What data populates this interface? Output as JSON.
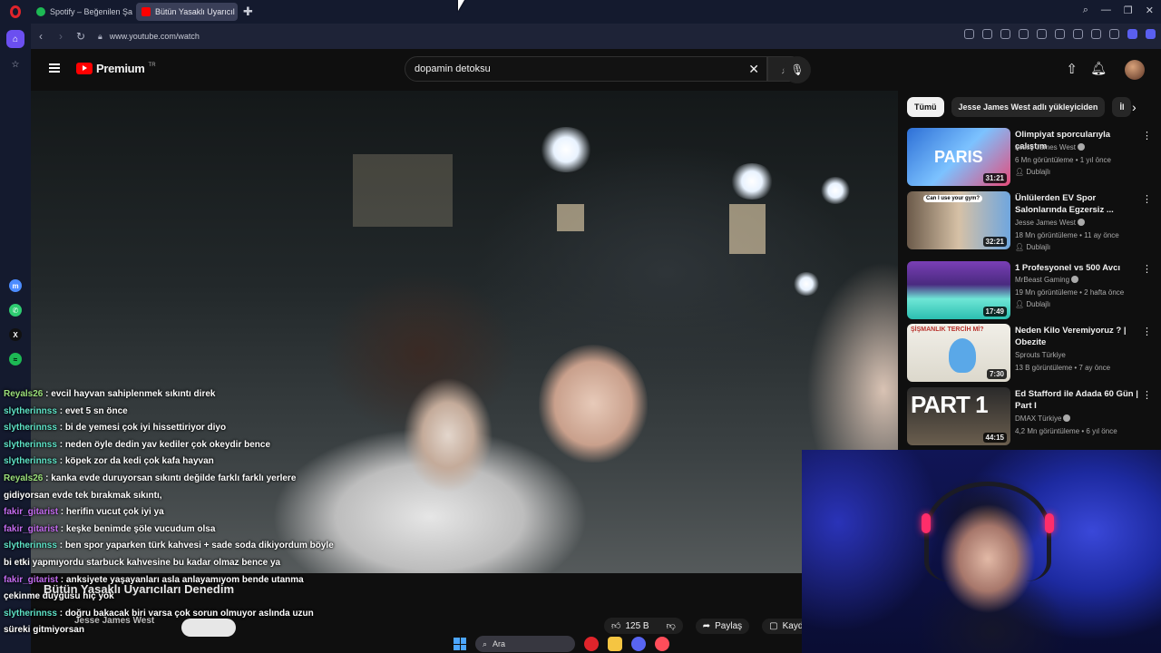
{
  "browser": {
    "tabs": [
      {
        "label": "Spotify – Beğenilen Şarkıl",
        "icon": "spotify-icon"
      },
      {
        "label": "Bütün Yasaklı Uyarıcıl",
        "icon": "youtube-icon"
      }
    ],
    "url": "www.youtube.com/watch"
  },
  "youtube": {
    "logo_text": "Premium",
    "logo_region": "TR",
    "search_query": "dopamin detoksu",
    "video_title": "Bütün Yasaklı Uyarıcıları Denedim",
    "channel_name": "Jesse James West",
    "dub_label": "Dublajlı",
    "like_count": "125 B",
    "share_label": "Paylaş",
    "save_label": "Kayde"
  },
  "chips": [
    {
      "label": "Tümü",
      "active": true
    },
    {
      "label": "Jesse James West adlı yükleyiciden",
      "active": false
    },
    {
      "label": "İl",
      "active": false
    }
  ],
  "recommendations": [
    {
      "title": "Olimpiyat sporcularıyla çalıştım",
      "channel": "Jesse James West",
      "meta": "6 Mn görüntüleme • 1 yıl önce",
      "badge": "Dublajlı",
      "duration": "31:21"
    },
    {
      "title": "Ünlülerden EV Spor Salonlarında Egzersiz ...",
      "channel": "Jesse James West",
      "meta": "18 Mn görüntüleme • 11 ay önce",
      "badge": "Dublajlı",
      "duration": "32:21"
    },
    {
      "title": "1 Profesyonel vs 500 Avcı",
      "channel": "MrBeast Gaming",
      "meta": "19 Mn görüntüleme • 2 hafta önce",
      "badge": "Dublajlı",
      "duration": "17:49"
    },
    {
      "title": "Neden Kilo Veremiyoruz ? | Obezite",
      "channel": "Sprouts Türkiye",
      "meta": "13 B görüntüleme • 7 ay önce",
      "badge": "",
      "duration": "7:30"
    },
    {
      "title": "Ed Stafford ile Adada 60 Gün | Part I",
      "channel": "DMAX Türkiye",
      "meta": "4,2 Mn görüntüleme • 6 yıl önce",
      "badge": "",
      "duration": "44:15"
    }
  ],
  "thumb_texts": {
    "paris": "PARIS",
    "gym": "Can I use your gym?",
    "sisman": "ŞİŞMANLIK TERCİH Mİ?",
    "part": "PART 1"
  },
  "chat": [
    {
      "user": "Reyals26",
      "color": "#9be07a",
      "text": "evcil hayvan sahiplenmek sıkıntı direk"
    },
    {
      "user": "slytherinnss",
      "color": "#5ee3c7",
      "text": "evet 5 sn önce"
    },
    {
      "user": "slytherinnss",
      "color": "#5ee3c7",
      "text": "bi de yemesi çok iyi hissettiriyor diyo"
    },
    {
      "user": "slytherinnss",
      "color": "#5ee3c7",
      "text": "neden öyle dedin yav kediler çok okeydir bence"
    },
    {
      "user": "slytherinnss",
      "color": "#5ee3c7",
      "text": "köpek zor da kedi çok kafa hayvan"
    },
    {
      "user": "Reyals26",
      "color": "#9be07a",
      "text": "kanka evde duruyorsan sıkıntı değilde farklı farklı yerlere"
    },
    {
      "user": "",
      "color": "#fff",
      "text": "gidiyorsan evde tek bırakmak sıkıntı,"
    },
    {
      "user": "fakir_gitarist",
      "color": "#c46cf0",
      "text": "herifin vucut çok iyi ya"
    },
    {
      "user": "fakir_gitarist",
      "color": "#c46cf0",
      "text": "keşke benimde şöle vucudum olsa"
    },
    {
      "user": "slytherinnss",
      "color": "#5ee3c7",
      "text": "ben spor yaparken türk kahvesi + sade soda dikiyordum böyle"
    },
    {
      "user": "",
      "color": "#fff",
      "text": "bi etki yapmıyordu starbuck kahvesine bu kadar olmaz bence ya"
    },
    {
      "user": "fakir_gitarist",
      "color": "#c46cf0",
      "text": "anksiyete yaşayanları asla anlayamıyom bende utanma"
    },
    {
      "user": "",
      "color": "#fff",
      "text": "çekinme duygusu hiç yok"
    },
    {
      "user": "slytherinnss",
      "color": "#5ee3c7",
      "text": "doğru bakacak biri varsa çok sorun olmuyor aslında uzun"
    },
    {
      "user": "",
      "color": "#fff",
      "text": "süreki gitmiyorsan"
    }
  ],
  "taskbar": {
    "search_label": "Ara"
  }
}
